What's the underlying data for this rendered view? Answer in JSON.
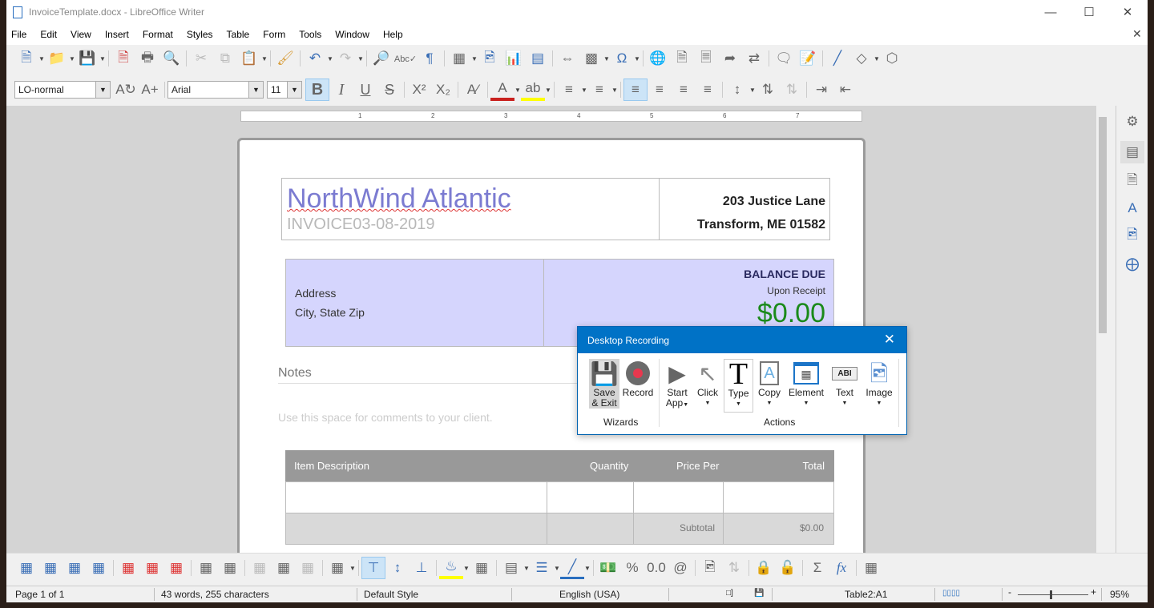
{
  "window": {
    "title": "InvoiceTemplate.docx - LibreOffice Writer"
  },
  "menu": [
    "File",
    "Edit",
    "View",
    "Insert",
    "Format",
    "Styles",
    "Table",
    "Form",
    "Tools",
    "Window",
    "Help"
  ],
  "format_bar": {
    "paragraph_style": "LO-normal",
    "font_name": "Arial",
    "font_size": "11"
  },
  "document": {
    "company": "NorthWind Atlantic",
    "invoice_line": "INVOICE03-08-2019",
    "address_line1": "203 Justice Lane",
    "address_line2": "Transform, ME 01582",
    "bill_address": "Address",
    "bill_city": "City, State Zip",
    "balance_label": "BALANCE DUE",
    "balance_terms": "Upon Receipt",
    "balance_amount": "$0.00",
    "notes_heading": "Notes",
    "notes_placeholder": "Use this space for comments to your client.",
    "table_headers": [
      "Item Description",
      "Quantity",
      "Price Per",
      "Total"
    ],
    "subtotal_label": "Subtotal",
    "subtotal_value": "$0.00"
  },
  "ruler_numbers": [
    "1",
    "2",
    "3",
    "4",
    "5",
    "6",
    "7"
  ],
  "dialog": {
    "title": "Desktop Recording",
    "buttons": [
      {
        "label": "Save",
        "label2": "& Exit"
      },
      {
        "label": "Record"
      },
      {
        "label": "Start",
        "label2": "App"
      },
      {
        "label": "Click"
      },
      {
        "label": "Type"
      },
      {
        "label": "Copy"
      },
      {
        "label": "Element"
      },
      {
        "label": "Text"
      },
      {
        "label": "Image"
      }
    ],
    "groups": [
      "Wizards",
      "Actions"
    ]
  },
  "status": {
    "page": "Page 1 of 1",
    "words": "43 words, 255 characters",
    "style": "Default Style",
    "language": "English (USA)",
    "cell": "Table2:A1",
    "zoom": "95%"
  },
  "bottom_toolbar": {
    "percent": "%",
    "decimal": "0.0",
    "at": "@",
    "sum": "Σ",
    "fx": "fx"
  }
}
